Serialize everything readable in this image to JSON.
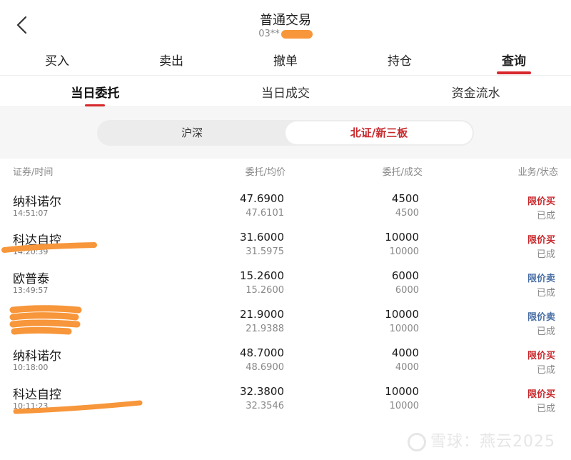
{
  "header": {
    "title": "普通交易",
    "account": "03**"
  },
  "main_tabs": [
    {
      "label": "买入"
    },
    {
      "label": "卖出"
    },
    {
      "label": "撤单"
    },
    {
      "label": "持仓"
    },
    {
      "label": "查询",
      "active": true
    }
  ],
  "sub_tabs": [
    {
      "label": "当日委托",
      "active": true
    },
    {
      "label": "当日成交"
    },
    {
      "label": "资金流水"
    }
  ],
  "segment": [
    {
      "label": "沪深"
    },
    {
      "label": "北证/新三板",
      "active": true
    }
  ],
  "table": {
    "headers": [
      "证券/时间",
      "委托/均价",
      "委托/成交",
      "业务/状态"
    ],
    "rows": [
      {
        "name": "纳科诺尔",
        "time": "14:51:07",
        "price": "47.6900",
        "avg": "47.6101",
        "qty": "4500",
        "filled": "4500",
        "type": "限价买",
        "status": "已成"
      },
      {
        "name": "科达自控",
        "time": "14:20:39",
        "price": "31.6000",
        "avg": "31.5975",
        "qty": "10000",
        "filled": "10000",
        "type": "限价买",
        "status": "已成"
      },
      {
        "name": "欧普泰",
        "time": "13:49:57",
        "price": "15.2600",
        "avg": "15.2600",
        "qty": "6000",
        "filled": "6000",
        "type": "限价卖",
        "status": "已成"
      },
      {
        "name": "",
        "time": "",
        "price": "21.9000",
        "avg": "21.9388",
        "qty": "10000",
        "filled": "10000",
        "type": "限价卖",
        "status": "已成"
      },
      {
        "name": "纳科诺尔",
        "time": "10:18:00",
        "price": "48.7000",
        "avg": "48.6900",
        "qty": "4000",
        "filled": "4000",
        "type": "限价买",
        "status": "已成"
      },
      {
        "name": "科达自控",
        "time": "10:11:23",
        "price": "32.3800",
        "avg": "32.3546",
        "qty": "10000",
        "filled": "10000",
        "type": "限价买",
        "status": "已成"
      }
    ]
  },
  "watermark": "雪球：燕云2025",
  "colors": {
    "accent": "#d8282c",
    "buy": "#c8282c",
    "sell": "#4a6fa5",
    "redaction": "#f7963a"
  },
  "icons": {
    "back": "chevron-left-icon",
    "watermark": "xueqiu-logo-icon"
  }
}
